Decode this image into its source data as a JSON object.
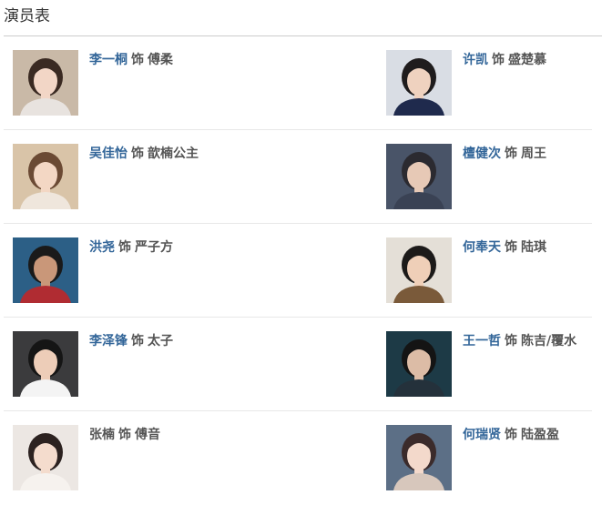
{
  "section": {
    "title": "演员表"
  },
  "cast": [
    {
      "actor": "李一桐",
      "sep": "饰",
      "role": "傅柔",
      "linked": true,
      "photo": "portrait-photo",
      "bg": "#c9b9a7",
      "skin": "#f2d6c6",
      "hair": "#3a2a22",
      "cloth": "#e8e3df"
    },
    {
      "actor": "许凯",
      "sep": "饰",
      "role": "盛楚慕",
      "linked": true,
      "photo": "portrait-photo",
      "bg": "#d9dde4",
      "skin": "#efd2bf",
      "hair": "#1f1c1d",
      "cloth": "#1f2a4d"
    },
    {
      "actor": "吴佳怡",
      "sep": "饰",
      "role": "歆楠公主",
      "linked": true,
      "photo": "portrait-photo",
      "bg": "#d9c4a8",
      "skin": "#f3d7c4",
      "hair": "#6b4a34",
      "cloth": "#efe6dc"
    },
    {
      "actor": "檀健次",
      "sep": "饰",
      "role": "周王",
      "linked": true,
      "photo": "portrait-photo",
      "bg": "#495468",
      "skin": "#e7c9b6",
      "hair": "#2b2a30",
      "cloth": "#3a4254"
    },
    {
      "actor": "洪尧",
      "sep": "饰",
      "role": "严子方",
      "linked": true,
      "photo": "portrait-photo",
      "bg": "#2c5f86",
      "skin": "#c99779",
      "hair": "#1a1a1a",
      "cloth": "#b02c32"
    },
    {
      "actor": "何奉天",
      "sep": "饰",
      "role": "陆琪",
      "linked": true,
      "photo": "portrait-photo",
      "bg": "#e4dfd7",
      "skin": "#efcfb8",
      "hair": "#1c1a19",
      "cloth": "#7a5a3a"
    },
    {
      "actor": "李泽锋",
      "sep": "饰",
      "role": "太子",
      "linked": true,
      "photo": "portrait-photo",
      "bg": "#3b3b3d",
      "skin": "#edcdb8",
      "hair": "#151515",
      "cloth": "#f4f4f4"
    },
    {
      "actor": "王一哲",
      "sep": "饰",
      "role": "陈吉/覆水",
      "linked": true,
      "photo": "portrait-photo",
      "bg": "#1d3a46",
      "skin": "#dcbca6",
      "hair": "#141414",
      "cloth": "#24313b"
    },
    {
      "actor": "张楠",
      "sep": "饰",
      "role": "傅音",
      "linked": false,
      "photo": "portrait-photo",
      "bg": "#ece7e3",
      "skin": "#f4dccd",
      "hair": "#2c2220",
      "cloth": "#f6f2ee"
    },
    {
      "actor": "何瑞贤",
      "sep": "饰",
      "role": "陆盈盈",
      "linked": true,
      "photo": "portrait-photo",
      "bg": "#5c6f86",
      "skin": "#f3d9cb",
      "hair": "#3b2b2b",
      "cloth": "#d7c7bc"
    }
  ]
}
